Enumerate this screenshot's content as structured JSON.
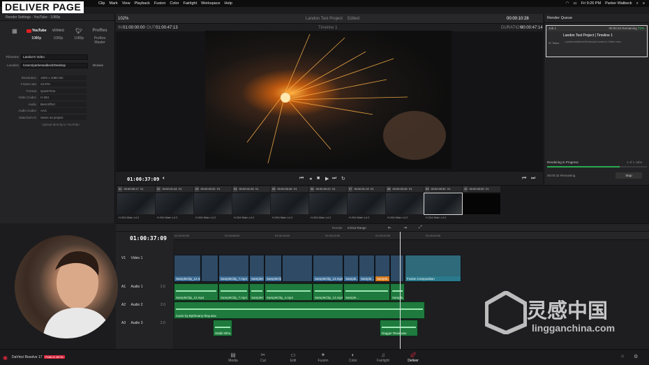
{
  "page_title": "DELIVER PAGE",
  "menubar": {
    "items": [
      "Clip",
      "Mark",
      "View",
      "Playback",
      "Fusion",
      "Color",
      "Fairlight",
      "Workspace",
      "Help"
    ],
    "clock": "Fri 9:26 PM",
    "user": "Parker Walbeck"
  },
  "left_panel": {
    "header": "Render Settings - YouTube - 1080p",
    "presets": [
      {
        "brand": "YouTube",
        "label": "1080p"
      },
      {
        "brand": "vimeo",
        "label": "1080p"
      },
      {
        "brand": "twitter",
        "label": "1080p"
      },
      {
        "brand": "ProRes",
        "label": "ProRes Master"
      }
    ],
    "filename_label": "Filename",
    "filename_value": "Landon's Video",
    "location_label": "Location",
    "location_value": "/Users/parkerwalbeck/Desktop",
    "browse_label": "Browse",
    "settings": [
      {
        "label": "Resolution",
        "value": "1920 x 1080 HD"
      },
      {
        "label": "Frame rate",
        "value": "23.976"
      },
      {
        "label": "Format",
        "value": "QuickTime"
      },
      {
        "label": "Video Codec",
        "value": "H.264"
      },
      {
        "label": "Audio",
        "value": "Best Effort"
      },
      {
        "label": "Audio Codec",
        "value": "AAC"
      },
      {
        "label": "Data burn-in",
        "value": "Same as project"
      }
    ],
    "upload_label": "Upload directly to YouTube"
  },
  "viewer": {
    "zoom": "102%",
    "project_title": "Landon Test Project",
    "project_state": "Edited",
    "timeline_name": "Timeline 1",
    "in_label": "IN",
    "in_tc": "01:00:00:00",
    "out_label": "OUT",
    "out_tc": "01:00:47:13",
    "top_tc": "00:00:10:28",
    "duration_label": "DURATION",
    "duration_tc": "00:00:47:14",
    "current_tc": "01:00:37:09"
  },
  "render_queue": {
    "title": "Render Queue",
    "job_id": "Job 1",
    "job_status": "00:00:32 Remaining",
    "job_percent": "73%",
    "job_name": "Landon Test Project | Timeline 1",
    "job_path": ".../parkerwalbeck/Desktop/Landon's Video.mov",
    "job_side": "ID Tasks",
    "progress_label": "Rendering in Progress",
    "progress_count": "1 of 1 Jobs",
    "progress": 0.73,
    "remaining": "00:00:32 Remaining",
    "stop_label": "Stop"
  },
  "clips": [
    {
      "num": "01",
      "tc": "00:00:00:17",
      "track": "V1",
      "codec": "H.264 Main L4.2"
    },
    {
      "num": "02",
      "tc": "00:00:01:44",
      "track": "V1",
      "codec": "H.264 Main L4.2"
    },
    {
      "num": "03",
      "tc": "00:00:03:32",
      "track": "V1",
      "codec": "H.264 Main L4.2"
    },
    {
      "num": "04",
      "tc": "00:00:01:28",
      "track": "V1",
      "codec": "H.264 Main L4.2"
    },
    {
      "num": "05",
      "tc": "00:00:00:46",
      "track": "V1",
      "codec": "H.264 Main L4.2"
    },
    {
      "num": "06",
      "tc": "00:00:00:22",
      "track": "V1",
      "codec": "H.264 Main L4.2"
    },
    {
      "num": "07",
      "tc": "00:00:01:19",
      "track": "V1",
      "codec": "H.264 Main L4.2"
    },
    {
      "num": "08",
      "tc": "00:00:03:45",
      "track": "V1",
      "codec": "H.264 Main L4.2"
    },
    {
      "num": "09",
      "tc": "00:00:09:52",
      "track": "V1",
      "codec": "H.264 Main L4.2"
    },
    {
      "num": "10",
      "tc": "00:00:00:00",
      "track": "V1",
      "codec": ""
    }
  ],
  "timeline": {
    "render_label": "Render",
    "render_value": "In/Out Range",
    "current_tc": "01:00:37:09",
    "ruler": [
      "01:00:00:00",
      "01:00:08:00",
      "01:00:16:00",
      "01:00:24:00",
      "01:00:32:00",
      "01:00:40:00"
    ],
    "tracks": [
      {
        "id": "V1",
        "name": "Video 1"
      },
      {
        "id": "A1",
        "name": "Audio 1",
        "level": "2.0"
      },
      {
        "id": "A2",
        "name": "Audio 2",
        "level": "2.0"
      },
      {
        "id": "A3",
        "name": "Audio 3",
        "level": "2.0"
      }
    ],
    "video_clips": [
      "SampleClip_12.mp4",
      "SampleClip_7.mp4",
      "SampleC...",
      "SampleClip_4.mp4",
      "SampleClip_13.mp4",
      "Sample...",
      "Sample...",
      "Sample...",
      "Fusion Composition"
    ],
    "a1_clips": [
      "SampleClip_12.mp4",
      "SampleClip_7.mp4",
      "SampleC...",
      "SampleClip_4.mp4",
      "SampleClip_13.mp4",
      "Sample...",
      "Sample..."
    ],
    "a2_clip": "music by Bythmany-thay.wav",
    "a3_clips": [
      "Stabb Whs...",
      "Dagger Riser.wav"
    ]
  },
  "pages": [
    {
      "name": "Media",
      "icon": "media-icon"
    },
    {
      "name": "Cut",
      "icon": "cut-icon"
    },
    {
      "name": "Edit",
      "icon": "edit-icon"
    },
    {
      "name": "Fusion",
      "icon": "fusion-icon"
    },
    {
      "name": "Color",
      "icon": "color-icon"
    },
    {
      "name": "Fairlight",
      "icon": "fairlight-icon"
    },
    {
      "name": "Deliver",
      "icon": "deliver-icon",
      "active": true
    }
  ],
  "app_name": "DaVinci Resolve 17",
  "app_badge": "PUBLIC BETA",
  "watermark_cn": "灵感中国",
  "watermark_en": "lingganchina.com",
  "colors": {
    "accent_red": "#d9263d",
    "video_clip": "#3a6b94",
    "audio_clip": "#1f7a3e",
    "progress": "#2ea84f"
  }
}
